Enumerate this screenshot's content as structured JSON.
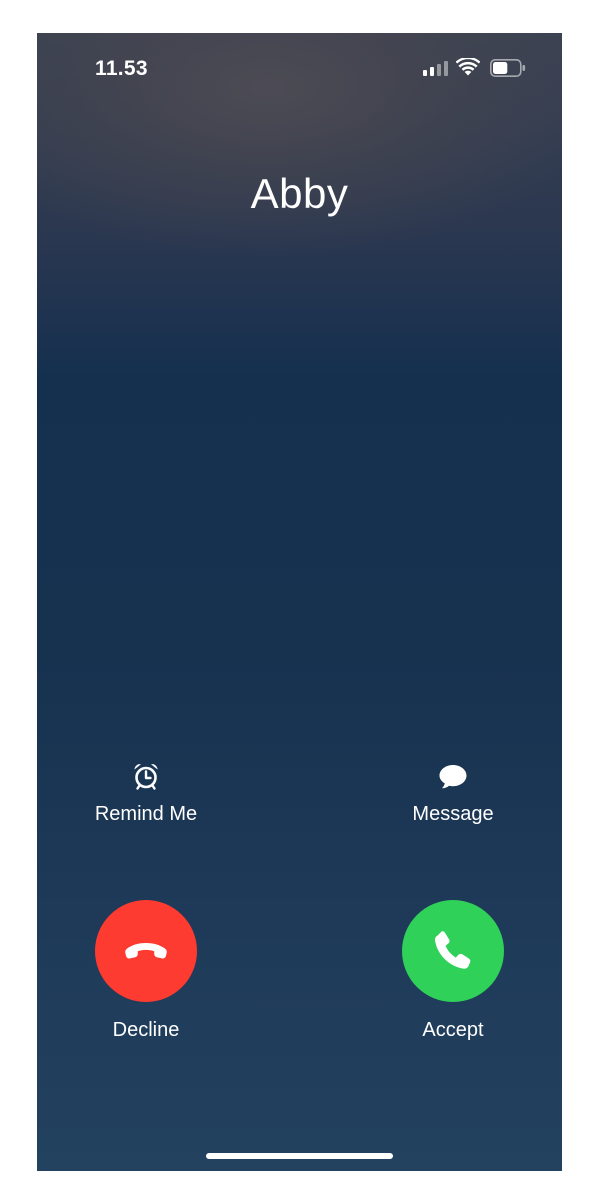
{
  "status_bar": {
    "time": "11.53",
    "signal_icon": "cellular-signal-icon",
    "wifi_icon": "wifi-icon",
    "battery_icon": "battery-icon",
    "battery_level": 0.55
  },
  "caller": {
    "name": "Abby"
  },
  "options": {
    "remind_me": {
      "label": "Remind Me",
      "icon": "alarm-clock-icon"
    },
    "message": {
      "label": "Message",
      "icon": "speech-bubble-icon"
    }
  },
  "actions": {
    "decline": {
      "label": "Decline",
      "icon": "phone-hangup-icon",
      "color": "#fe3b30"
    },
    "accept": {
      "label": "Accept",
      "icon": "phone-icon",
      "color": "#2fd158"
    }
  },
  "colors": {
    "background_top": "#3b4252",
    "background_mid": "#15304f",
    "background_bottom": "#234260",
    "text": "#ffffff"
  }
}
